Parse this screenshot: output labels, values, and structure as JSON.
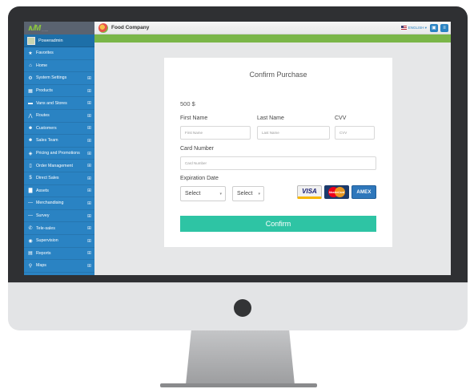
{
  "sidebar": {
    "user_name": "Poweradmin",
    "items": [
      {
        "icon": "star-icon",
        "glyph": "★",
        "label": "Favorites",
        "expandable": false
      },
      {
        "icon": "home-icon",
        "glyph": "⌂",
        "label": "Home",
        "expandable": false
      },
      {
        "icon": "gears-icon",
        "glyph": "⚙",
        "label": "System Settings",
        "expandable": true
      },
      {
        "icon": "grid-icon",
        "glyph": "▦",
        "label": "Products",
        "expandable": true
      },
      {
        "icon": "truck-icon",
        "glyph": "▬",
        "label": "Vans and Stores",
        "expandable": true
      },
      {
        "icon": "road-icon",
        "glyph": "⋀",
        "label": "Routes",
        "expandable": true
      },
      {
        "icon": "users-icon",
        "glyph": "☻",
        "label": "Customers",
        "expandable": true
      },
      {
        "icon": "team-icon",
        "glyph": "☻",
        "label": "Sales Team",
        "expandable": true
      },
      {
        "icon": "tag-icon",
        "glyph": "◈",
        "label": "Pricing and Promotions",
        "expandable": true
      },
      {
        "icon": "document-icon",
        "glyph": "▯",
        "label": "Order Management",
        "expandable": true
      },
      {
        "icon": "dollar-icon",
        "glyph": "$",
        "label": "Direct Sales",
        "expandable": true
      },
      {
        "icon": "building-icon",
        "glyph": "▇",
        "label": "Assets",
        "expandable": true
      },
      {
        "icon": "minus-icon",
        "glyph": "—",
        "label": "Merchandising",
        "expandable": true
      },
      {
        "icon": "minus-icon",
        "glyph": "—",
        "label": "Survey",
        "expandable": true
      },
      {
        "icon": "phone-icon",
        "glyph": "✆",
        "label": "Tele-sales",
        "expandable": true
      },
      {
        "icon": "eye-icon",
        "glyph": "◉",
        "label": "Supervision",
        "expandable": true
      },
      {
        "icon": "chart-icon",
        "glyph": "▤",
        "label": "Reports",
        "expandable": true
      },
      {
        "icon": "pin-icon",
        "glyph": "⚲",
        "label": "Maps",
        "expandable": true
      }
    ]
  },
  "topbar": {
    "company_name": "Food Company",
    "language": "ENGLISH ▾"
  },
  "purchase": {
    "title": "Confirm Purchase",
    "amount": "500 $",
    "first_name_label": "First Name",
    "first_name_placeholder": "First Name",
    "last_name_label": "Last Name",
    "last_name_placeholder": "Last Name",
    "cvv_label": "CVV",
    "cvv_placeholder": "CVV",
    "card_number_label": "Card Number",
    "card_number_placeholder": "Card Number",
    "expiration_label": "Expiration Date",
    "month_select": "Select",
    "year_select": "Select",
    "cards": {
      "visa": "VISA",
      "mastercard": "MasterCard",
      "amex": "AMEX"
    },
    "confirm_label": "Confirm"
  },
  "colors": {
    "sidebar": "#2a83c3",
    "accent_green": "#7ab648",
    "confirm_button": "#2ec4a4"
  }
}
